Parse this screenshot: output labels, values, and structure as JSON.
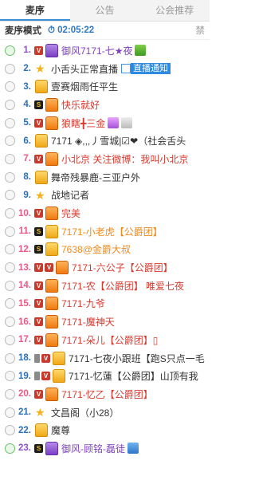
{
  "tabs": [
    "麦序",
    "公告",
    "公会推荐"
  ],
  "mode": {
    "label": "麦序模式",
    "timer_prefix": "⏱ 02:05:22",
    "right": "禁"
  },
  "rows": [
    {
      "num": "1.",
      "mic": "g",
      "numcolor": "purple",
      "badges": [
        "v"
      ],
      "avatar": "purple",
      "name": "御风7171-七★夜",
      "namecolor": "c-purple",
      "tags": [
        "lv"
      ]
    },
    {
      "num": "2.",
      "mic": "o",
      "numcolor": "",
      "badges": [],
      "avatar": "star",
      "name": "小舌头正常直播",
      "namecolor": "c-dark",
      "notice": "直播通知"
    },
    {
      "num": "3.",
      "mic": "o",
      "numcolor": "",
      "badges": [],
      "avatar": "gold",
      "name": "壹赛烟雨任平生",
      "namecolor": "c-dark",
      "tags": []
    },
    {
      "num": "4.",
      "mic": "o",
      "numcolor": "",
      "badges": [
        "s"
      ],
      "avatar": "orange",
      "name": "快乐就好",
      "namecolor": "c-red",
      "tags": []
    },
    {
      "num": "5.",
      "mic": "o",
      "numcolor": "",
      "badges": [
        "v"
      ],
      "avatar": "orange",
      "name": "狼瞎╋三金",
      "namecolor": "c-red",
      "tags": [
        "lv2",
        "card"
      ]
    },
    {
      "num": "6.",
      "mic": "o",
      "numcolor": "",
      "badges": [],
      "avatar": "gold",
      "name": "7171 ◈,,,丿雪城|☑❤（社会舌头",
      "namecolor": "c-dark",
      "tags": []
    },
    {
      "num": "7.",
      "mic": "o",
      "numcolor": "pink",
      "badges": [
        "v"
      ],
      "avatar": "orange",
      "name": "小北京 关注微博：我叫小北京",
      "namecolor": "c-red",
      "tags": []
    },
    {
      "num": "8.",
      "mic": "o",
      "numcolor": "",
      "badges": [],
      "avatar": "gold",
      "name": "舞帝残暴鹿-三亚户外",
      "namecolor": "c-dark",
      "tags": []
    },
    {
      "num": "9.",
      "mic": "o",
      "numcolor": "",
      "badges": [],
      "avatar": "star",
      "name": "战地记者",
      "namecolor": "c-dark",
      "tags": []
    },
    {
      "num": "10.",
      "mic": "o",
      "numcolor": "pink",
      "badges": [
        "v"
      ],
      "avatar": "orange",
      "name": "完美",
      "namecolor": "c-red",
      "tags": []
    },
    {
      "num": "11.",
      "mic": "o",
      "numcolor": "pink",
      "badges": [
        "s"
      ],
      "avatar": "gold",
      "name": "7171-小老虎【公爵团】",
      "namecolor": "c-orange",
      "tags": []
    },
    {
      "num": "12.",
      "mic": "o",
      "numcolor": "pink",
      "badges": [
        "s"
      ],
      "avatar": "gold",
      "name": "7638@金爵大叔",
      "namecolor": "c-orange",
      "tags": []
    },
    {
      "num": "13.",
      "mic": "o",
      "numcolor": "pink",
      "badges": [
        "v",
        "v"
      ],
      "avatar": "orange",
      "name": "7171-六公子【公爵团】",
      "namecolor": "c-red",
      "tags": []
    },
    {
      "num": "14.",
      "mic": "o",
      "numcolor": "pink",
      "badges": [
        "v"
      ],
      "avatar": "orange",
      "name": "7171-农【公爵团】 唯爱七夜",
      "namecolor": "c-red",
      "tags": []
    },
    {
      "num": "15.",
      "mic": "o",
      "numcolor": "pink",
      "badges": [
        "v"
      ],
      "avatar": "orange",
      "name": "7171-九爷",
      "namecolor": "c-red",
      "tags": []
    },
    {
      "num": "16.",
      "mic": "o",
      "numcolor": "pink",
      "badges": [
        "v"
      ],
      "avatar": "orange",
      "name": "7171-魔神天",
      "namecolor": "c-red",
      "tags": []
    },
    {
      "num": "17.",
      "mic": "o",
      "numcolor": "pink",
      "badges": [
        "v"
      ],
      "avatar": "orange",
      "name": "7171-朵儿【公爵团】▯",
      "namecolor": "c-red",
      "tags": []
    },
    {
      "num": "18.",
      "mic": "o",
      "numcolor": "",
      "badges": [
        "phone",
        "v"
      ],
      "avatar": "gold",
      "name": "7171-七夜小跟班【跑S只点一毛",
      "namecolor": "c-dark",
      "tags": []
    },
    {
      "num": "19.",
      "mic": "o",
      "numcolor": "",
      "badges": [
        "phone",
        "v"
      ],
      "avatar": "gold",
      "name": "7171-忆蓮【公爵团】山顶有我",
      "namecolor": "c-dark",
      "tags": []
    },
    {
      "num": "20.",
      "mic": "o",
      "numcolor": "pink",
      "badges": [
        "v"
      ],
      "avatar": "orange",
      "name": "7171-忆乙【公爵团】",
      "namecolor": "c-red",
      "tags": []
    },
    {
      "num": "21.",
      "mic": "o",
      "numcolor": "",
      "badges": [],
      "avatar": "star",
      "name": "文昌阁（小28）",
      "namecolor": "c-dark",
      "tags": []
    },
    {
      "num": "22.",
      "mic": "o",
      "numcolor": "",
      "badges": [],
      "avatar": "gold",
      "name": "魔尊",
      "namecolor": "c-dark",
      "tags": []
    },
    {
      "num": "23.",
      "mic": "g",
      "numcolor": "purple",
      "badges": [
        "s"
      ],
      "avatar": "purple",
      "name": "御风-顾铭-磊徒",
      "namecolor": "c-purple",
      "tags": [
        "lvb"
      ]
    }
  ]
}
